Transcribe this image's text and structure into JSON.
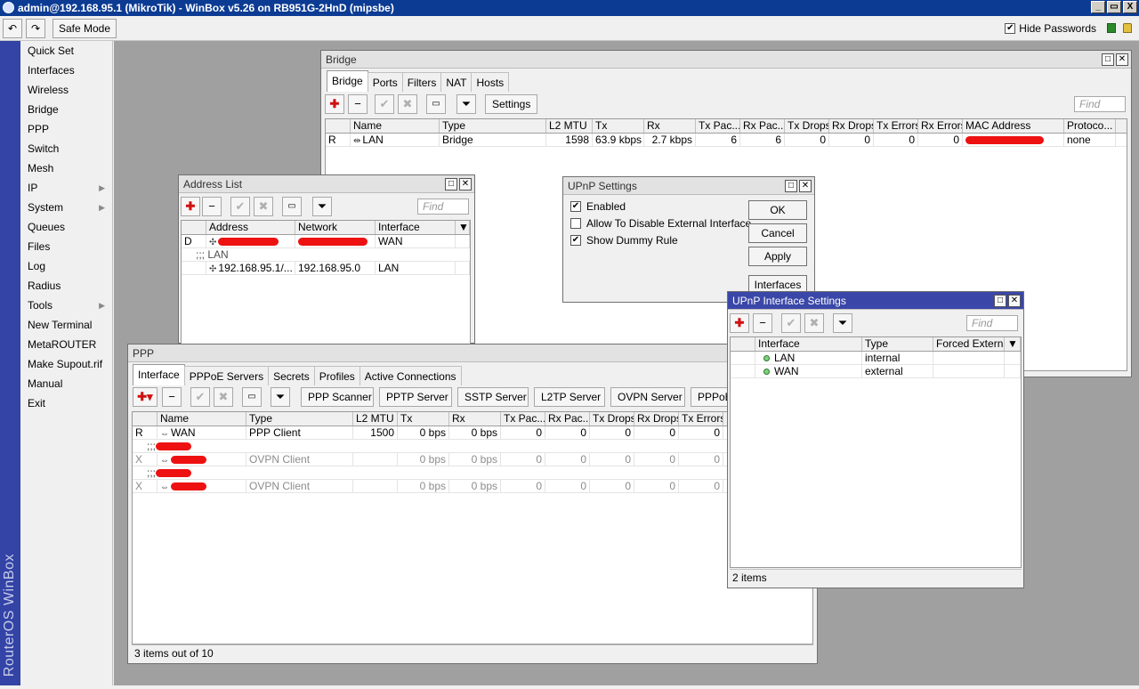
{
  "window": {
    "title": "admin@192.168.95.1 (MikroTik) - WinBox v5.26 on RB951G-2HnD (mipsbe)",
    "controls": [
      "_",
      "▭",
      "X"
    ]
  },
  "toolbar": {
    "undo_label": "↶",
    "redo_label": "↷",
    "safe_mode": "Safe Mode",
    "hide_passwords": "Hide Passwords",
    "hide_passwords_checked": true
  },
  "sidebar": {
    "brand": "RouterOS WinBox",
    "items": [
      {
        "label": "Quick Set",
        "submenu": false
      },
      {
        "label": "Interfaces",
        "submenu": false
      },
      {
        "label": "Wireless",
        "submenu": false
      },
      {
        "label": "Bridge",
        "submenu": false
      },
      {
        "label": "PPP",
        "submenu": false
      },
      {
        "label": "Switch",
        "submenu": false
      },
      {
        "label": "Mesh",
        "submenu": false
      },
      {
        "label": "IP",
        "submenu": true
      },
      {
        "label": "System",
        "submenu": true
      },
      {
        "label": "Queues",
        "submenu": false
      },
      {
        "label": "Files",
        "submenu": false
      },
      {
        "label": "Log",
        "submenu": false
      },
      {
        "label": "Radius",
        "submenu": false
      },
      {
        "label": "Tools",
        "submenu": true
      },
      {
        "label": "New Terminal",
        "submenu": false
      },
      {
        "label": "MetaROUTER",
        "submenu": false
      },
      {
        "label": "Make Supout.rif",
        "submenu": false
      },
      {
        "label": "Manual",
        "submenu": false
      },
      {
        "label": "Exit",
        "submenu": false
      }
    ]
  },
  "bridge": {
    "title": "Bridge",
    "tabs": [
      "Bridge",
      "Ports",
      "Filters",
      "NAT",
      "Hosts"
    ],
    "settings_label": "Settings",
    "find_placeholder": "Find",
    "columns": [
      "",
      "Name",
      "Type",
      "L2 MTU",
      "Tx",
      "Rx",
      "Tx Pac...",
      "Rx Pac...",
      "Tx Drops",
      "Rx Drops",
      "Tx Errors",
      "Rx Errors",
      "MAC Address",
      "Protoco..."
    ],
    "rows": [
      {
        "flag": "R",
        "name": "LAN",
        "type": "Bridge",
        "l2mtu": "1598",
        "tx": "63.9 kbps",
        "rx": "2.7 kbps",
        "txp": "6",
        "rxp": "6",
        "txd": "0",
        "rxd": "0",
        "txe": "0",
        "rxe": "0",
        "mac": "",
        "proto": "none"
      }
    ]
  },
  "address_list": {
    "title": "Address List",
    "find_placeholder": "Find",
    "columns": [
      "",
      "Address",
      "Network",
      "Interface"
    ],
    "rows": [
      {
        "flag": "D",
        "address": "",
        "network": "",
        "interface": "WAN"
      },
      {
        "comment": ";;; LAN"
      },
      {
        "flag": "",
        "address": "192.168.95.1/...",
        "network": "192.168.95.0",
        "interface": "LAN"
      }
    ]
  },
  "upnp": {
    "title": "UPnP Settings",
    "options": [
      {
        "label": "Enabled",
        "checked": true
      },
      {
        "label": "Allow To Disable External Interface",
        "checked": false
      },
      {
        "label": "Show Dummy Rule",
        "checked": true
      }
    ],
    "buttons": [
      "OK",
      "Cancel",
      "Apply",
      "Interfaces"
    ]
  },
  "upnp_iface": {
    "title": "UPnP Interface Settings",
    "find_placeholder": "Find",
    "columns": [
      "Interface",
      "Type",
      "Forced Extern..."
    ],
    "rows": [
      {
        "interface": "LAN",
        "type": "internal",
        "forced": ""
      },
      {
        "interface": "WAN",
        "type": "external",
        "forced": ""
      }
    ],
    "status": "2 items"
  },
  "ppp": {
    "title": "PPP",
    "tabs": [
      "Interface",
      "PPPoE Servers",
      "Secrets",
      "Profiles",
      "Active Connections"
    ],
    "buttons": [
      "PPP Scanner",
      "PPTP Server",
      "SSTP Server",
      "L2TP Server",
      "OVPN Server",
      "PPPoE Sc"
    ],
    "columns": [
      "",
      "Name",
      "Type",
      "L2 MTU",
      "Tx",
      "Rx",
      "Tx Pac...",
      "Rx Pac...",
      "Tx Drops",
      "Rx Drops",
      "Tx Errors"
    ],
    "rows": [
      {
        "flag": "R",
        "name": "WAN",
        "type": "PPP Client",
        "l2mtu": "1500",
        "tx": "0 bps",
        "rx": "0 bps",
        "txp": "0",
        "rxp": "0",
        "txd": "0",
        "rxd": "0",
        "txe": "0",
        "dim": false
      },
      {
        "comment": ";;;"
      },
      {
        "flag": "X",
        "name": "",
        "type": "OVPN Client",
        "l2mtu": "",
        "tx": "0 bps",
        "rx": "0 bps",
        "txp": "0",
        "rxp": "0",
        "txd": "0",
        "rxd": "0",
        "txe": "0",
        "dim": true
      },
      {
        "comment": ";;;"
      },
      {
        "flag": "X",
        "name": "",
        "type": "OVPN Client",
        "l2mtu": "",
        "tx": "0 bps",
        "rx": "0 bps",
        "txp": "0",
        "rxp": "0",
        "txd": "0",
        "rxd": "0",
        "txe": "0",
        "dim": true
      }
    ],
    "status": "3 items out of 10"
  },
  "colors": {
    "title_bar": "#0c3b93",
    "active_window": "#3a47a8",
    "add_icon": "#d01010",
    "redaction": "#e11111"
  },
  "icons": {
    "add": "add-icon",
    "remove": "remove-icon",
    "enable": "check-icon",
    "disable": "cross-icon",
    "comment": "comment-icon",
    "filter": "filter-icon"
  }
}
